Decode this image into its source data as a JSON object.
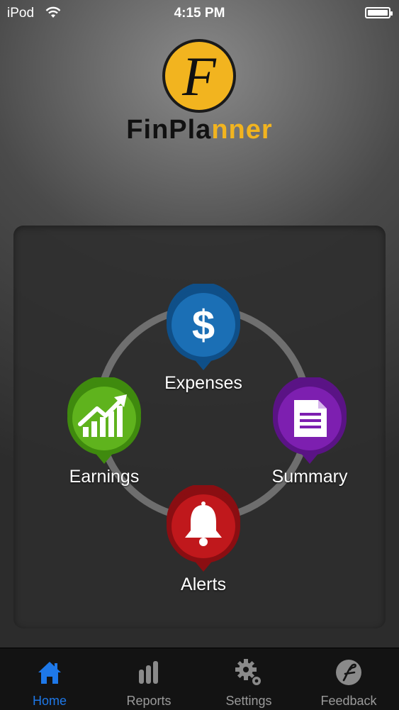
{
  "status_bar": {
    "carrier": "iPod",
    "time": "4:15 PM"
  },
  "logo": {
    "initial": "F",
    "name_part1": "FinPla",
    "name_part2": "nner"
  },
  "menu": {
    "items": [
      {
        "label": "Expenses",
        "icon": "dollar-icon",
        "color": "#1b6fb5"
      },
      {
        "label": "Earnings",
        "icon": "rising-chart-icon",
        "color": "#5fb31d"
      },
      {
        "label": "Summary",
        "icon": "document-icon",
        "color": "#7d1fb0"
      },
      {
        "label": "Alerts",
        "icon": "bell-icon",
        "color": "#c0181c"
      }
    ]
  },
  "tab_bar": {
    "tabs": [
      {
        "label": "Home",
        "icon": "home-icon",
        "active": true
      },
      {
        "label": "Reports",
        "icon": "bar-chart-icon",
        "active": false
      },
      {
        "label": "Settings",
        "icon": "gears-icon",
        "active": false
      },
      {
        "label": "Feedback",
        "icon": "feedback-icon",
        "active": false
      }
    ],
    "active_color": "#1e78e8",
    "inactive_color": "#9a9a9a"
  }
}
